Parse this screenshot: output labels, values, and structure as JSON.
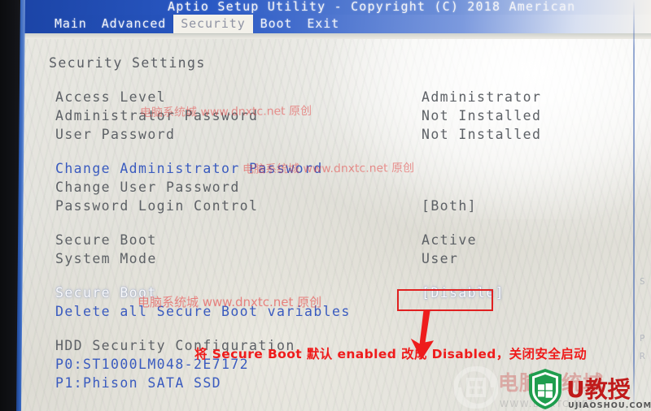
{
  "colors": {
    "title_bar_blue": "#2a59c4",
    "screen_bg": "#e7e6e0",
    "label_gray": "#5d6166",
    "link_blue": "#3a5bbf",
    "selected_white": "#fbfbfb",
    "marker_red": "#e02020",
    "annotation_red": "#ef1b1b",
    "watermark_red": "rgba(228,60,60,0.52)"
  },
  "header": {
    "title": "Aptio Setup Utility - Copyright (C) 2018 American",
    "menu": [
      {
        "label": "Main",
        "active": false
      },
      {
        "label": "Advanced",
        "active": false
      },
      {
        "label": "Security",
        "active": true
      },
      {
        "label": "Boot",
        "active": false
      },
      {
        "label": "Exit",
        "active": false
      }
    ]
  },
  "page": {
    "section_title": "Security Settings",
    "groups": [
      {
        "rows": [
          {
            "label": "Access Level",
            "value": "Administrator",
            "style": "label"
          },
          {
            "label": "Administrator Password",
            "value": "Not Installed",
            "style": "label"
          },
          {
            "label": "User Password",
            "value": "Not Installed",
            "style": "label"
          }
        ]
      },
      {
        "rows": [
          {
            "label": "Change Administrator Password",
            "value": "",
            "style": "link"
          },
          {
            "label": "Change User Password",
            "value": "",
            "style": "label"
          },
          {
            "label": "Password Login Control",
            "value": "[Both]",
            "style": "label"
          }
        ]
      },
      {
        "rows": [
          {
            "label": "Secure Boot",
            "value": "Active",
            "style": "label"
          },
          {
            "label": "System Mode",
            "value": "User",
            "style": "label"
          }
        ]
      },
      {
        "rows": [
          {
            "label": "Secure Boot",
            "value": "[Disable]",
            "style": "selected"
          },
          {
            "label": "Delete all Secure Boot variables",
            "value": "",
            "style": "link"
          }
        ]
      },
      {
        "rows": [
          {
            "label": "HDD Security Configuration",
            "value": "",
            "style": "label"
          },
          {
            "label": "P0:ST1000LM048-2E7172",
            "value": "",
            "style": "link"
          },
          {
            "label": "P1:Phison SATA SSD",
            "value": "",
            "style": "link"
          }
        ]
      }
    ]
  },
  "annotation": {
    "text": "将 Secure Boot 默认 enabled 改成 Disabled，关闭安全启动",
    "marker_target": "[Disable]"
  },
  "watermarks": {
    "text": "电脑系统城 www.dnxtc.net 原创",
    "occurrences": 3
  },
  "logos": {
    "dnxtc_name": "电脑系统城",
    "dnxtc_url": "WWW.DNXTC.NET",
    "ujiaoshou_name": "U教授",
    "ujiaoshou_url": "UJIAOSHOU.COM"
  },
  "ghost_pane": {
    "lines": [
      "S",
      "P",
      "R"
    ]
  }
}
